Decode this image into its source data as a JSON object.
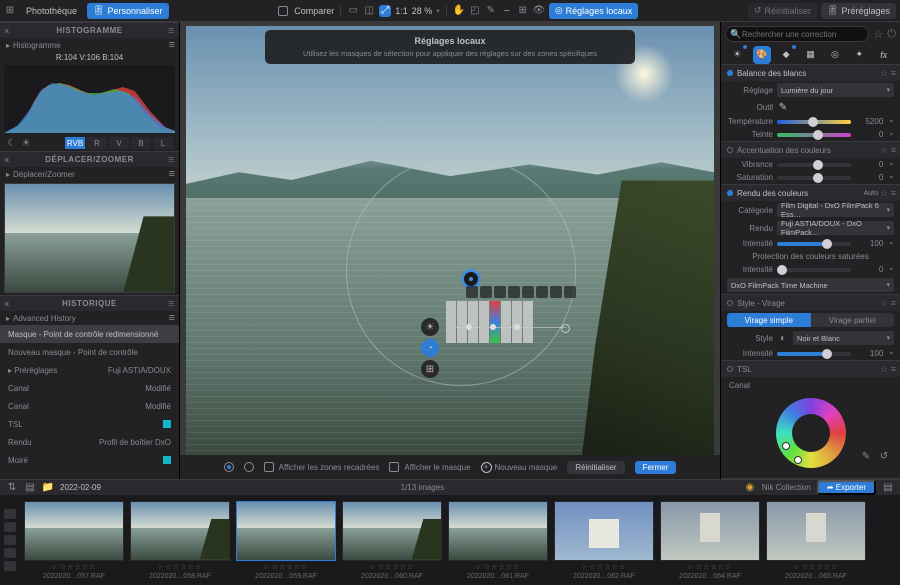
{
  "topbar": {
    "library": "Photothèque",
    "customize": "Personnaliser",
    "compare": "Comparer",
    "ratio": "1:1",
    "zoom": "28 %",
    "local": "Réglages locaux",
    "reset": "Réinitialiser",
    "presets": "Préréglages"
  },
  "hint": {
    "title": "Réglages locaux",
    "sub": "Utilisez les masques de sélection pour appliquer des réglages sur des zones spécifiques"
  },
  "left": {
    "histogram": {
      "title": "HISTOGRAMME",
      "sub": "Histogramme",
      "rgb": "R:104 V:106 B:104",
      "channels": [
        "RVB",
        "R",
        "V",
        "B",
        "L"
      ],
      "activeChannel": "RVB"
    },
    "move": {
      "title": "DÉPLACER/ZOOMER",
      "sub": "Déplacer/Zoomer"
    },
    "history": {
      "title": "HISTORIQUE",
      "sub": "Advanced History",
      "rows": [
        {
          "label": "Masque - Point de contrôle redimensionné",
          "value": "",
          "style": "sel"
        },
        {
          "label": "Nouveau masque - Point de contrôle",
          "value": "",
          "style": ""
        },
        {
          "label": "Préréglages",
          "value": "Fuji ASTIA/DOUX",
          "style": "indent"
        },
        {
          "label": "Canal",
          "value": "Modifié",
          "style": ""
        },
        {
          "label": "Canal",
          "value": "Modifié",
          "style": ""
        },
        {
          "label": "TSL",
          "value": "sq",
          "style": ""
        },
        {
          "label": "Rendu",
          "value": "Profil de boîtier DxO",
          "style": ""
        },
        {
          "label": "Moiré",
          "value": "sq",
          "style": ""
        }
      ]
    }
  },
  "centerBottom": {
    "crop": "Afficher les zones recadrées",
    "mask": "Afficher le masque",
    "new": "Nouveau masque",
    "reset": "Réinitialiser",
    "close": "Fermer"
  },
  "right": {
    "search": "Rechercher une correction",
    "wb": {
      "title": "Balance des blancs",
      "setting_lbl": "Réglage",
      "setting_val": "Lumière du jour",
      "tool_lbl": "Outil",
      "temp_lbl": "Température",
      "temp_val": "5200",
      "tint_lbl": "Teinte",
      "tint_val": "0"
    },
    "accent": {
      "title": "Accentuation des couleurs",
      "vib_lbl": "Vibrance",
      "vib_val": "0",
      "sat_lbl": "Saturation",
      "sat_val": "0"
    },
    "render": {
      "title": "Rendu des couleurs",
      "auto": "Auto",
      "cat_lbl": "Catégorie",
      "cat_val": "Film Digital - DxO FilmPack 6 Ess…",
      "rend_lbl": "Rendu",
      "rend_val": "Fuji ASTIA/DOUX - DxO FilmPack…",
      "int_lbl": "Intensité",
      "int_val": "100",
      "protect": "Protection des couleurs saturées",
      "prot_int_lbl": "Intensité",
      "prot_int_val": "0",
      "time": "DxO FilmPack Time Machine"
    },
    "style": {
      "title": "Style - Virage",
      "seg_a": "Virage simple",
      "seg_b": "Virage partiel",
      "style_lbl": "Style",
      "style_val": "Noir et Blanc",
      "int_lbl": "Intensité",
      "int_val": "100"
    },
    "tsl": {
      "title": "TSL",
      "channel": "Canal",
      "colors": [
        "#808080",
        "#d04040",
        "#e08030",
        "#e0c030",
        "#60c040",
        "#30c0a0",
        "#3080e0",
        "#6040d0",
        "#c040c0"
      ]
    }
  },
  "fsbar": {
    "folder": "2022-02-09",
    "count": "1/13 images",
    "nik": "Nik Collection",
    "export": "Exporter"
  },
  "thumbs": [
    {
      "name": "2022020…057.RAF"
    },
    {
      "name": "2022020…058.RAF"
    },
    {
      "name": "2022020…059.RAF"
    },
    {
      "name": "2022020…060.RAF"
    },
    {
      "name": "2022020…061.RAF"
    },
    {
      "name": "2022020…062.RAF"
    },
    {
      "name": "2022020…064.RAF"
    },
    {
      "name": "2022020…065.RAF"
    }
  ],
  "selectedThumb": 2
}
